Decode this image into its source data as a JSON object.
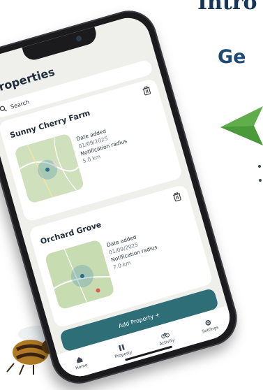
{
  "background": {
    "heading_partial": "Intro",
    "subheading_partial": "Ge",
    "accent_color": "#5fae4b"
  },
  "app": {
    "title": "Properties",
    "search": {
      "placeholder": "Search",
      "icon": "search-icon"
    },
    "properties": [
      {
        "name": "Sunny Cherry Farm",
        "date_label": "Date added",
        "date_value": "01/09/2025",
        "radius_label": "Notification radius",
        "radius_value": "5.0 km"
      },
      {
        "name": "Orchard Grove",
        "date_label": "Date added",
        "date_value": "01/09/2025",
        "radius_label": "Notification radius",
        "radius_value": "7.0 km"
      }
    ],
    "add_button_label": "Add Property +",
    "nav": [
      {
        "label": "Home",
        "icon": "home-icon"
      },
      {
        "label": "Property",
        "icon": "property-icon"
      },
      {
        "label": "Activity",
        "icon": "activity-icon"
      },
      {
        "label": "Settings",
        "icon": "settings-icon"
      }
    ],
    "colors": {
      "primary": "#2e6e76",
      "screen_bg": "#efefec"
    }
  }
}
